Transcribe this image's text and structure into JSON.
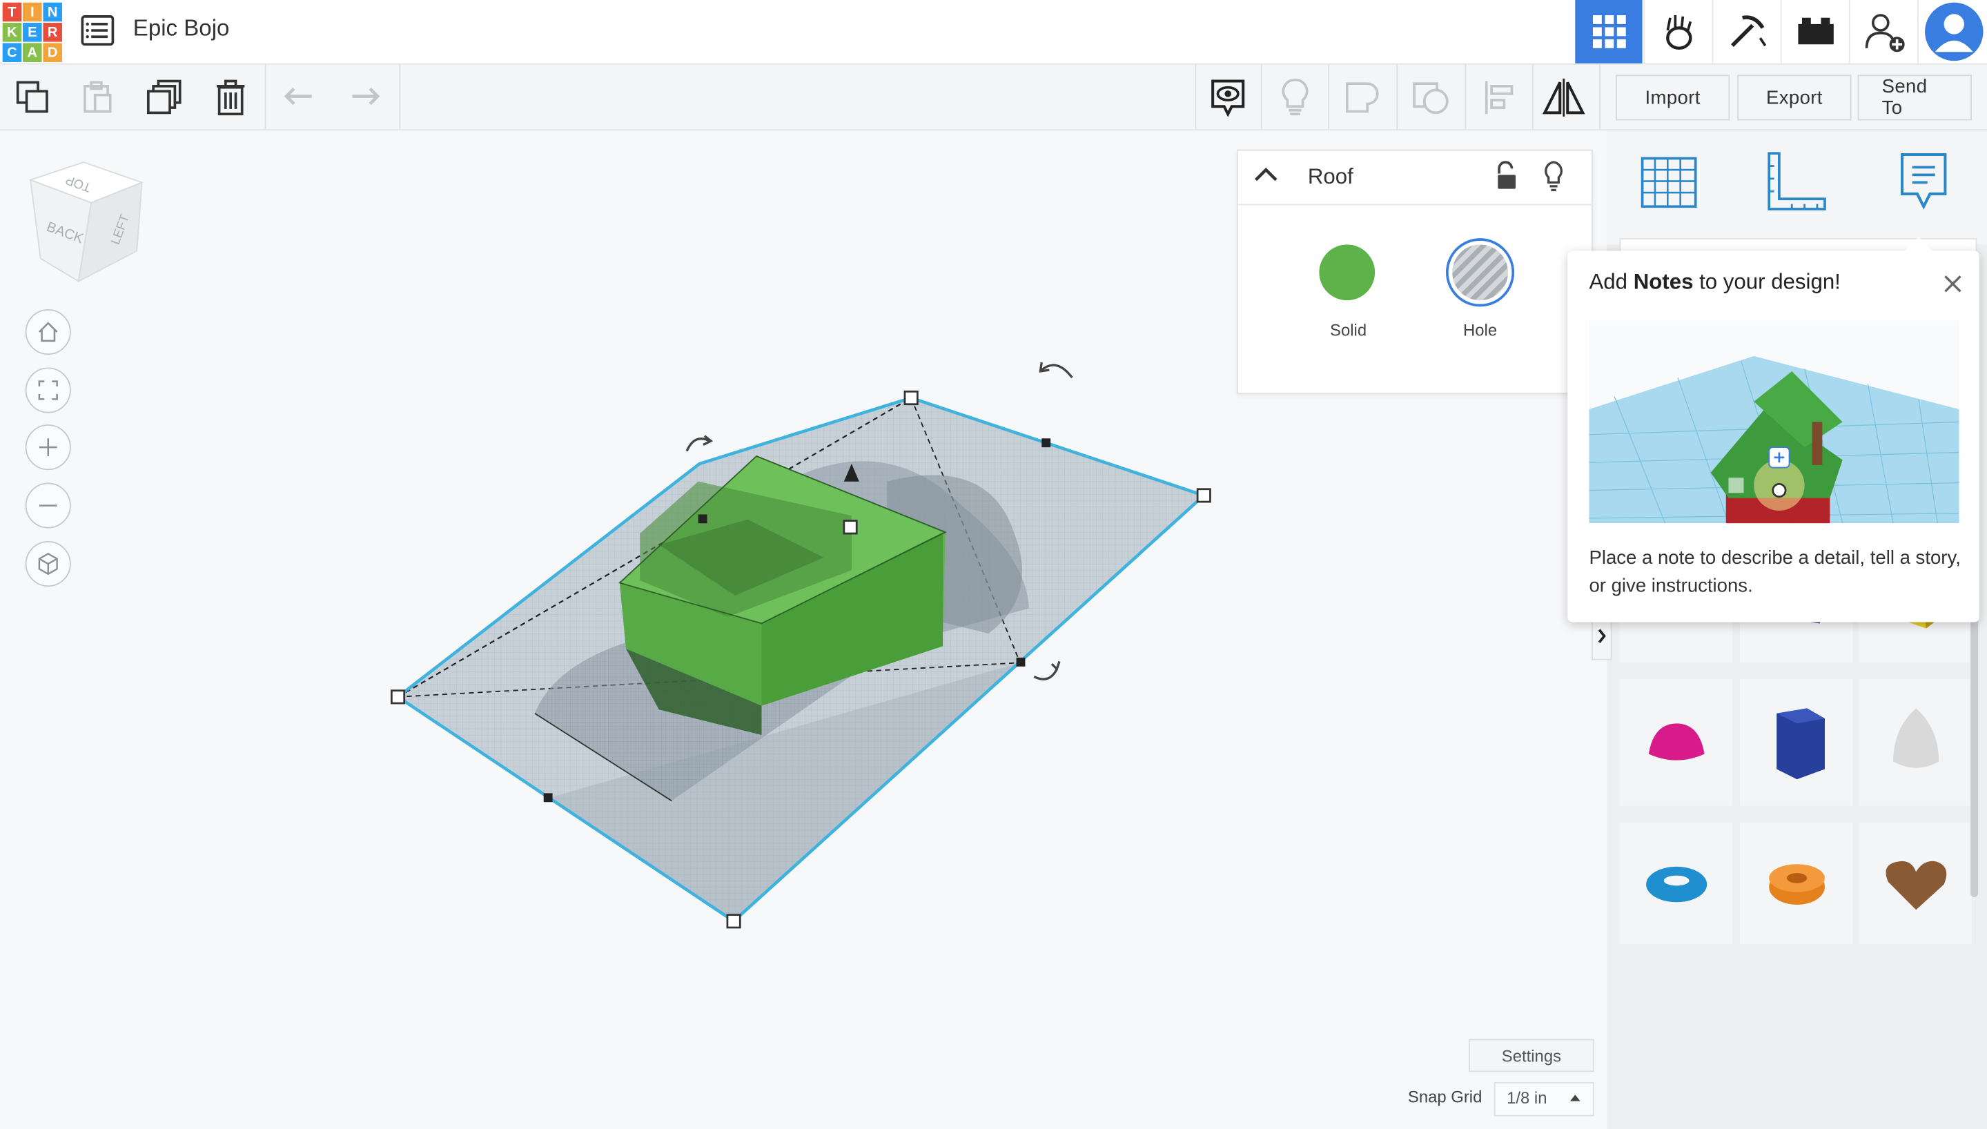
{
  "app": {
    "logo_letters": [
      "T",
      "I",
      "N",
      "K",
      "E",
      "R",
      "C",
      "A",
      "D"
    ],
    "logo_colors": [
      "#e84e3c",
      "#f3a33b",
      "#2a9df4",
      "#86c04a",
      "#2a9df4",
      "#e84e3c",
      "#2a9df4",
      "#86c04a",
      "#f3a33b"
    ],
    "design_name": "Epic Bojo"
  },
  "header": {
    "buttons": [
      {
        "name": "3d-design-view-icon",
        "active": true
      },
      {
        "name": "user-profile-hand-icon"
      },
      {
        "name": "blocks-pickaxe-icon"
      },
      {
        "name": "bricks-icon"
      },
      {
        "name": "add-user-icon"
      },
      {
        "name": "avatar"
      }
    ],
    "accent_color": "#3a7de0"
  },
  "toolbar": {
    "copy_icon": "copy-icon",
    "paste_icon": "paste-icon",
    "duplicate_icon": "duplicate-icon",
    "delete_icon": "trash-icon",
    "undo_icon": "undo-icon",
    "redo_icon": "redo-icon",
    "notes_icon": "eye-notes-icon",
    "light_icon": "lightbulb-icon",
    "group_icon": "group-icon",
    "ungroup_icon": "ungroup-icon",
    "align_icon": "align-icon",
    "mirror_icon": "mirror-icon",
    "import_label": "Import",
    "export_label": "Export",
    "send_label": "Send To"
  },
  "viewcube": {
    "faces": [
      "TOP",
      "BACK",
      "LEFT"
    ]
  },
  "view_controls": [
    "home-view-icon",
    "fit-view-icon",
    "zoom-in-icon",
    "zoom-out-icon",
    "perspective-cube-icon"
  ],
  "shape_panel": {
    "title": "Roof",
    "solid_label": "Solid",
    "hole_label": "Hole",
    "solid_color": "#5db34a"
  },
  "right_panel": {
    "tabs": [
      "workplane-grid-icon",
      "ruler-icon",
      "notes-icon"
    ],
    "collapse_icon": "chevron-right-icon"
  },
  "notes_popup": {
    "title_pre": "Add ",
    "title_bold": "Notes",
    "title_post": " to your design!",
    "body": "Place a note to describe a detail, tell a story, or give instructions."
  },
  "shapes": [
    {
      "name": "roof-shape",
      "color": "#3d9a3d"
    },
    {
      "name": "cone-shape",
      "color": "#7a2f9a"
    },
    {
      "name": "round-roof-shape",
      "color": "#6bbdc9"
    },
    {
      "name": "text-shape",
      "color": "#c62828"
    },
    {
      "name": "polygon-shape",
      "color": "#243c8c"
    },
    {
      "name": "pyramid-shape",
      "color": "#e6c821"
    },
    {
      "name": "half-sphere-shape",
      "color": "#d81b8a"
    },
    {
      "name": "hexagonal-prism-shape",
      "color": "#26409c"
    },
    {
      "name": "paraboloid-shape",
      "color": "#d9d9d9"
    },
    {
      "name": "torus-shape",
      "color": "#1f8fd0"
    },
    {
      "name": "tube-shape",
      "color": "#e6821e"
    },
    {
      "name": "heart-shape",
      "color": "#8a5a35"
    }
  ],
  "bottom": {
    "settings_label": "Settings",
    "snap_label": "Snap Grid",
    "snap_value": "1/8 in"
  }
}
